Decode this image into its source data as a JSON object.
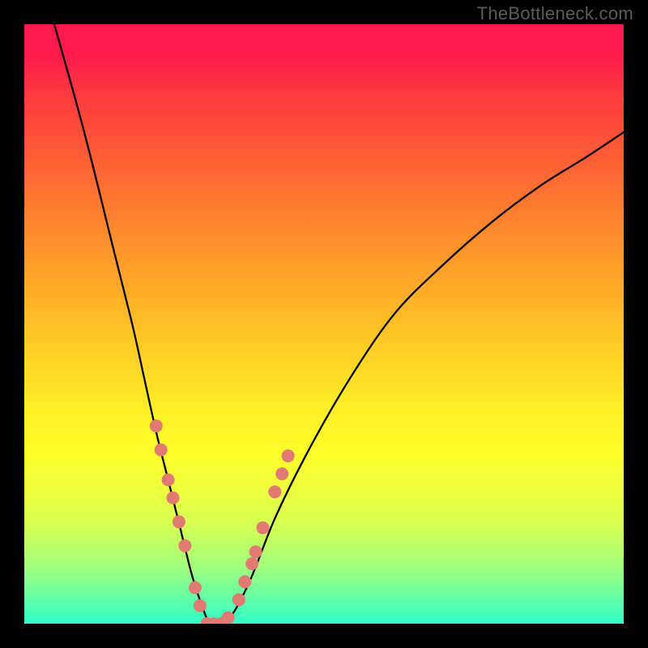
{
  "watermark": "TheBottleneck.com",
  "chart_data": {
    "type": "line",
    "title": "",
    "xlabel": "",
    "ylabel": "",
    "xlim": [
      0,
      100
    ],
    "ylim": [
      0,
      100
    ],
    "legend": false,
    "background_gradient": {
      "top": "#ff1a4d",
      "bottom": "#30ffc8",
      "meaning": "top = high bottleneck, bottom = low bottleneck"
    },
    "series": [
      {
        "name": "bottleneck-curve",
        "x": [
          5,
          10,
          15,
          18,
          20,
          22,
          24,
          26,
          28,
          30,
          31,
          32,
          33,
          35,
          38,
          42,
          48,
          55,
          62,
          70,
          78,
          86,
          94,
          100
        ],
        "y": [
          100,
          82,
          62,
          50,
          41,
          32,
          24,
          16,
          8,
          2,
          0,
          0,
          0,
          2,
          8,
          18,
          30,
          42,
          52,
          60,
          67,
          73,
          78,
          82
        ]
      }
    ],
    "markers": {
      "name": "highlighted-points",
      "color": "#e07a72",
      "radius_px": 8,
      "points": [
        {
          "x": 22.0,
          "y": 33
        },
        {
          "x": 22.8,
          "y": 29
        },
        {
          "x": 24.0,
          "y": 24
        },
        {
          "x": 24.8,
          "y": 21
        },
        {
          "x": 25.8,
          "y": 17
        },
        {
          "x": 26.8,
          "y": 13
        },
        {
          "x": 28.5,
          "y": 6
        },
        {
          "x": 29.3,
          "y": 3
        },
        {
          "x": 30.5,
          "y": 0
        },
        {
          "x": 31.5,
          "y": 0
        },
        {
          "x": 32.8,
          "y": 0
        },
        {
          "x": 34.0,
          "y": 1
        },
        {
          "x": 35.8,
          "y": 4
        },
        {
          "x": 36.8,
          "y": 7
        },
        {
          "x": 38.0,
          "y": 10
        },
        {
          "x": 38.6,
          "y": 12
        },
        {
          "x": 39.8,
          "y": 16
        },
        {
          "x": 41.8,
          "y": 22
        },
        {
          "x": 43.0,
          "y": 25
        },
        {
          "x": 44.0,
          "y": 28
        }
      ]
    }
  }
}
